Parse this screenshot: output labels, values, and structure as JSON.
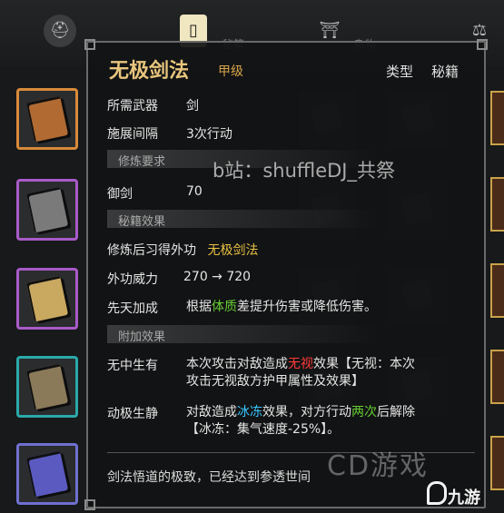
{
  "tabs": [
    {
      "icon": "helmet-icon",
      "label": ""
    },
    {
      "icon": "book-tab-icon",
      "label": "秘籍"
    },
    {
      "icon": "lantern-icon",
      "label": "杂物"
    },
    {
      "icon": "scale-icon",
      "label": ""
    }
  ],
  "left_slots": [
    {
      "border": "#d98a3a",
      "book": "#b06a32"
    },
    {
      "border": "#a95ac9",
      "book": "#7a7a7a"
    },
    {
      "border": "#a95ac9",
      "book": "#c9a860"
    },
    {
      "border": "#2aa9a9",
      "book": "#8a7a5a"
    },
    {
      "border": "#7070d0",
      "book": "#5a5ac0"
    }
  ],
  "detail": {
    "title": "无极剑法",
    "grade": "甲级",
    "type_label": "类型",
    "type_value": "秘籍",
    "weapon_label": "所需武器",
    "weapon_value": "剑",
    "interval_label": "施展间隔",
    "interval_value": "3次行动",
    "section_requirements": "修炼要求",
    "req_label": "御剑",
    "req_value": "70",
    "section_effects": "秘籍效果",
    "learn_prefix": "修炼后习得外功",
    "learn_value": "无极剑法",
    "power_label": "外功威力",
    "power_value": "270 → 720",
    "innate_label": "先天加成",
    "innate_text_1": "根据",
    "innate_highlight": "体质",
    "innate_text_2": "差提升伤害或降低伤害。",
    "section_extra": "附加效果",
    "extra1_label": "无中生有",
    "extra1_text_1": "本次攻击对敌造成",
    "extra1_highlight": "无视",
    "extra1_text_2": "效果【无视：本次",
    "extra1_line2": "攻击无视敌方护甲属性及效果】",
    "extra2_label": "动极生静",
    "extra2_text_1": "对敌造成",
    "extra2_highlight": "冰冻",
    "extra2_text_2": "效果，对方行动",
    "extra2_highlight2": "两次",
    "extra2_text_3": "后解除",
    "extra2_line2": "【冰冻：集气速度-25%】。",
    "footer": "剑法悟道的极致，已经达到参透世间"
  },
  "watermarks": {
    "bilibili": "b站：shuffleDJ_共祭",
    "cd": "CD游戏",
    "jiuyou": "九游"
  },
  "colors": {
    "title": "#e7c57d",
    "highlight_green": "#66cc33",
    "highlight_red": "#ff3a3a",
    "highlight_cyan": "#38c8ff",
    "highlight_gold": "#e8c044"
  }
}
